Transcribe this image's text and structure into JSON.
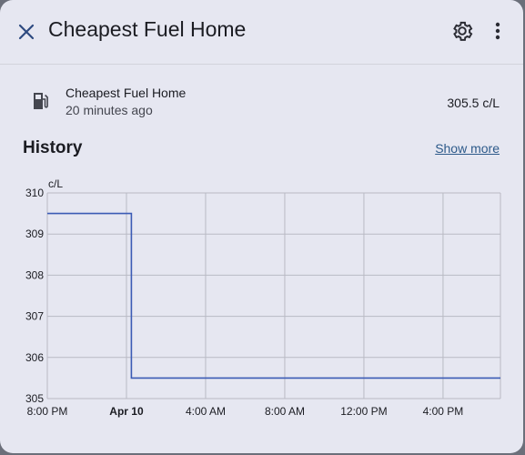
{
  "header": {
    "title": "Cheapest Fuel Home",
    "close_icon": "close-icon",
    "settings_icon": "gear-icon",
    "menu_icon": "more-vertical-icon"
  },
  "entity": {
    "icon": "gas-station-icon",
    "name": "Cheapest Fuel Home",
    "last_changed": "20 minutes ago",
    "state": "305.5 c/L"
  },
  "history": {
    "title": "History",
    "show_more_label": "Show more"
  },
  "colors": {
    "accent": "#3b5bb5",
    "link": "#2d5a8a",
    "background": "#e6e7f1"
  },
  "chart_data": {
    "type": "line",
    "step": true,
    "ylabel": "c/L",
    "ylim": [
      305,
      310
    ],
    "yticks": [
      "310",
      "309",
      "308",
      "307",
      "306",
      "305"
    ],
    "xticks": [
      {
        "label": "8:00 PM",
        "bold": false,
        "hour": 0
      },
      {
        "label": "Apr 10",
        "bold": true,
        "hour": 4
      },
      {
        "label": "4:00 AM",
        "bold": false,
        "hour": 8
      },
      {
        "label": "8:00 AM",
        "bold": false,
        "hour": 12
      },
      {
        "label": "12:00 PM",
        "bold": false,
        "hour": 16
      },
      {
        "label": "4:00 PM",
        "bold": false,
        "hour": 20
      }
    ],
    "xlim_hours": [
      0,
      22.9
    ],
    "series": [
      {
        "points": [
          {
            "hour": 0,
            "value": 309.5
          },
          {
            "hour": 4.25,
            "value": 309.5
          },
          {
            "hour": 4.25,
            "value": 305.5
          },
          {
            "hour": 22.9,
            "value": 305.5
          }
        ]
      }
    ],
    "grid": true
  }
}
